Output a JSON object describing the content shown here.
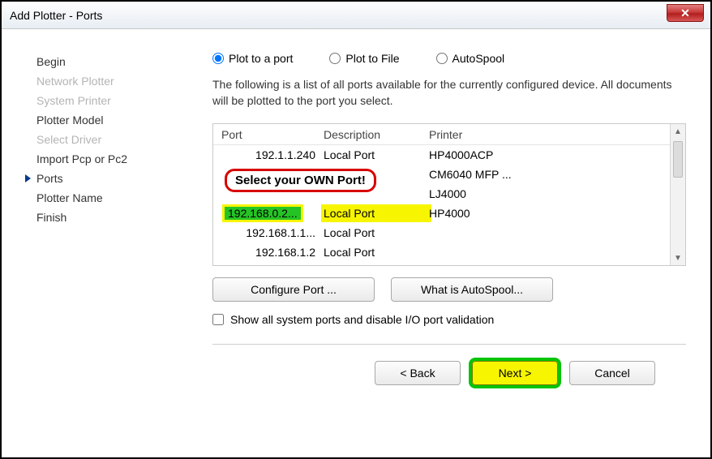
{
  "window_title": "Add Plotter - Ports",
  "steps": [
    {
      "label": "Begin",
      "state": "normal"
    },
    {
      "label": "Network Plotter",
      "state": "disabled"
    },
    {
      "label": "System Printer",
      "state": "disabled"
    },
    {
      "label": "Plotter Model",
      "state": "normal"
    },
    {
      "label": "Select Driver",
      "state": "disabled"
    },
    {
      "label": "Import Pcp or Pc2",
      "state": "normal"
    },
    {
      "label": "Ports",
      "state": "current"
    },
    {
      "label": "Plotter Name",
      "state": "normal"
    },
    {
      "label": "Finish",
      "state": "normal"
    }
  ],
  "radios": {
    "plot_port": "Plot to a port",
    "plot_file": "Plot to File",
    "autospool": "AutoSpool",
    "selected": "plot_port"
  },
  "description": "The following is a list of all ports available for the currently configured device. All documents will be plotted to the port you select.",
  "table": {
    "headers": {
      "port": "Port",
      "desc": "Description",
      "printer": "Printer"
    },
    "rows": [
      {
        "port": "192.1.1.240",
        "desc": "Local Port",
        "printer": "HP4000ACP",
        "selected": false
      },
      {
        "port": "",
        "desc": "",
        "printer": "CM6040 MFP ...",
        "selected": false
      },
      {
        "port": "",
        "desc": "",
        "printer": "LJ4000",
        "selected": false
      },
      {
        "port": "192.168.0.2...",
        "desc": "Local Port",
        "printer": "HP4000",
        "selected": true
      },
      {
        "port": "192.168.1.1...",
        "desc": "Local Port",
        "printer": "",
        "selected": false
      },
      {
        "port": "192.168.1.2",
        "desc": "Local Port",
        "printer": "",
        "selected": false
      }
    ]
  },
  "annotation": "Select your OWN Port!",
  "buttons": {
    "configure": "Configure Port ...",
    "autospool": "What is AutoSpool...",
    "back": "< Back",
    "next": "Next >",
    "cancel": "Cancel"
  },
  "checkbox_label": "Show all system ports and disable I/O port validation"
}
